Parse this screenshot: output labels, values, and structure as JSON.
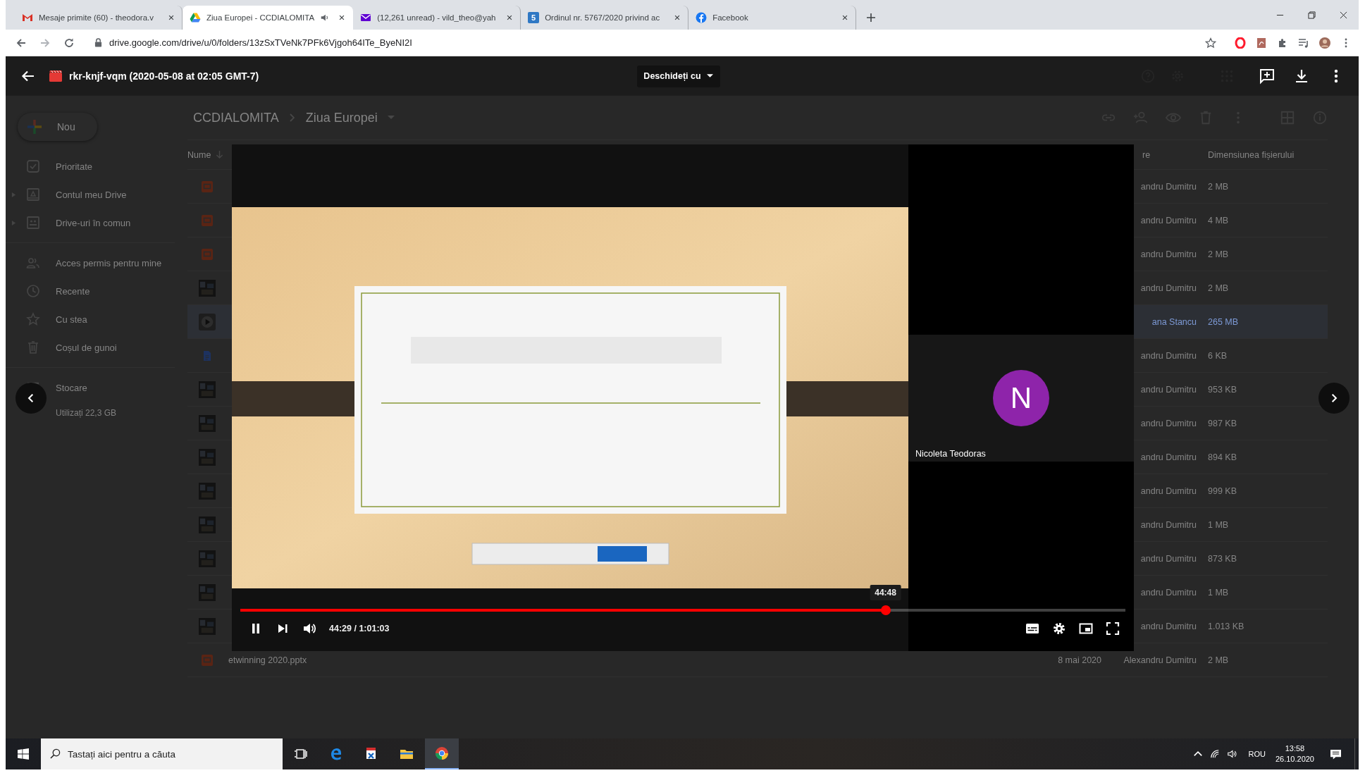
{
  "browser": {
    "tabs": [
      {
        "kind": "gmail",
        "title": "Mesaje primite (60) - theodora.v",
        "selected": false,
        "audio": false
      },
      {
        "kind": "drive",
        "title": "Ziua Europei - CCDIALOMITA",
        "selected": true,
        "audio": true
      },
      {
        "kind": "yahoo",
        "title": "(12,261 unread) - vild_theo@yah",
        "selected": false,
        "audio": false
      },
      {
        "kind": "document",
        "favicon_label": "5",
        "title": "Ordinul nr. 5767/2020 privind ac",
        "selected": false,
        "audio": false
      },
      {
        "kind": "facebook",
        "title": "Facebook",
        "selected": false,
        "audio": false
      }
    ],
    "url": "drive.google.com/drive/u/0/folders/13zSxTVeNk7PFk6Vjgoh64ITe_ByeNI2I"
  },
  "viewer": {
    "title": "rkr-knjf-vqm (2020-05-08 at 02:05 GMT-7)",
    "open_with": "Deschideți cu"
  },
  "drive": {
    "new_button": "Nou",
    "sidebar_groups": [
      {
        "items": [
          {
            "kind": "priority",
            "label": "Prioritate",
            "expandable": false
          },
          {
            "kind": "my-drive",
            "label": "Contul meu Drive",
            "expandable": true
          },
          {
            "kind": "shared-drives",
            "label": "Drive-uri în comun",
            "expandable": true
          }
        ]
      },
      {
        "items": [
          {
            "kind": "shared",
            "label": "Acces permis pentru mine",
            "expandable": false
          },
          {
            "kind": "recent",
            "label": "Recente",
            "expandable": false
          },
          {
            "kind": "starred",
            "label": "Cu stea",
            "expandable": false
          },
          {
            "kind": "trash",
            "label": "Coșul de gunoi",
            "expandable": false
          }
        ]
      }
    ],
    "storage": {
      "label": "Stocare",
      "usage": "Utilizați 22,3 GB"
    },
    "breadcrumb": [
      "CCDIALOMITA",
      "Ziua Europei"
    ],
    "columns": {
      "name": "Nume",
      "owner": "re",
      "size": "Dimensiunea fișierului"
    },
    "rows": [
      {
        "kind": "slides",
        "owner": "andru Dumitru",
        "size": "2 MB",
        "selected": false
      },
      {
        "kind": "slides",
        "owner": "andru Dumitru",
        "size": "4 MB",
        "selected": false
      },
      {
        "kind": "slides",
        "owner": "andru Dumitru",
        "size": "2 MB",
        "selected": false
      },
      {
        "kind": "image",
        "owner": "andru Dumitru",
        "size": "2 MB",
        "selected": false
      },
      {
        "kind": "video",
        "owner": "ana Stancu",
        "size": "265 MB",
        "selected": true
      },
      {
        "kind": "doc",
        "owner": "andru Dumitru",
        "size": "6 KB",
        "selected": false
      },
      {
        "kind": "image",
        "owner": "andru Dumitru",
        "size": "953 KB",
        "selected": false
      },
      {
        "kind": "image",
        "owner": "andru Dumitru",
        "size": "987 KB",
        "selected": false
      },
      {
        "kind": "image",
        "owner": "andru Dumitru",
        "size": "894 KB",
        "selected": false
      },
      {
        "kind": "image",
        "owner": "andru Dumitru",
        "size": "999 KB",
        "selected": false
      },
      {
        "kind": "image",
        "owner": "andru Dumitru",
        "size": "1 MB",
        "selected": false
      },
      {
        "kind": "image",
        "owner": "andru Dumitru",
        "size": "873 KB",
        "selected": false
      },
      {
        "kind": "image",
        "owner": "andru Dumitru",
        "size": "1 MB",
        "selected": false
      },
      {
        "kind": "image",
        "owner": "andru Dumitru",
        "size": "1.013 KB",
        "selected": false
      },
      {
        "kind": "slides",
        "name": "etwinning 2020.pptx",
        "date": "8 mai 2020",
        "owner": "Alexandru Dumitru",
        "size": "2 MB",
        "selected": false
      }
    ]
  },
  "player": {
    "playing": true,
    "level": 0.729,
    "hover_time": "44:48",
    "time": "44:29 / 1:01:03",
    "participant": {
      "initial": "N",
      "name": "Nicoleta Teodoras"
    }
  },
  "taskbar": {
    "search_placeholder": "Tastați aici pentru a căuta",
    "apps": [
      {
        "kind": "task-view",
        "active": false
      },
      {
        "kind": "edge",
        "active": false
      },
      {
        "kind": "pdf",
        "active": false
      },
      {
        "kind": "explorer",
        "active": false
      },
      {
        "kind": "chrome",
        "active": true
      }
    ],
    "language": "ROU",
    "time": "13:58",
    "date": "26.10.2020"
  }
}
